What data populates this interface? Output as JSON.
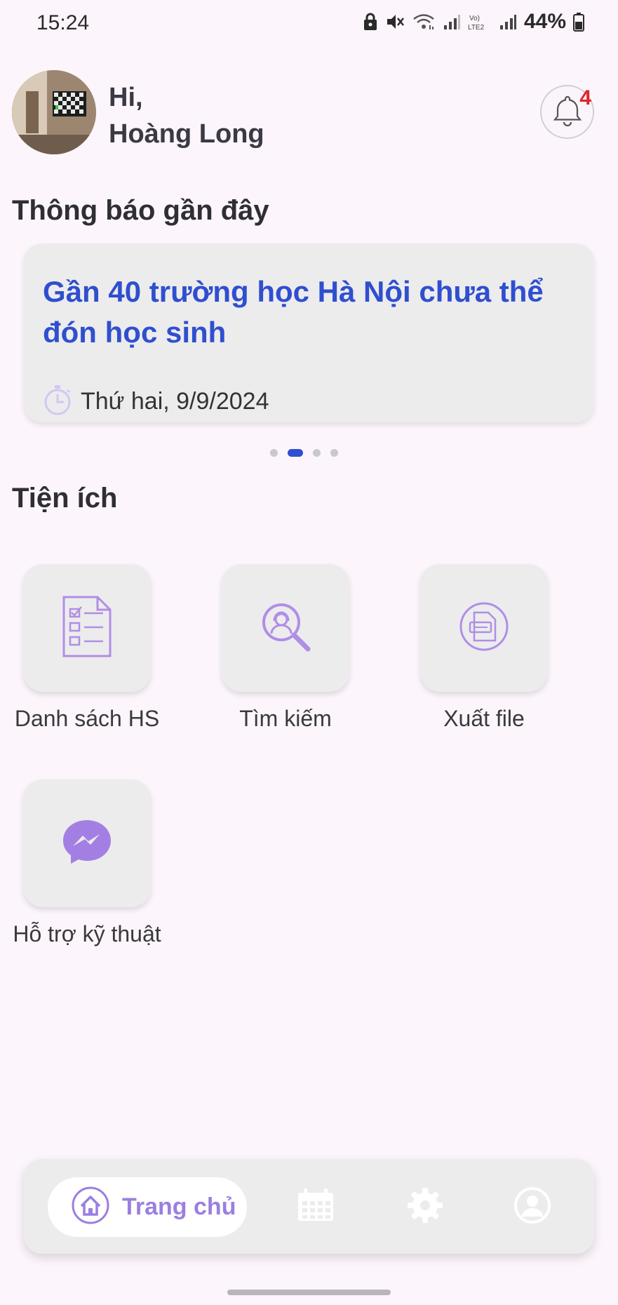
{
  "status_bar": {
    "time": "15:24",
    "battery": "44%",
    "network_label": "Vo) LTE2",
    "icons": [
      "lock-icon",
      "mute-icon",
      "wifi-icon",
      "signal-icon",
      "volte-icon",
      "signal-icon",
      "battery-icon"
    ]
  },
  "header": {
    "greeting": "Hi,",
    "user_name": "Hoàng Long",
    "notification_count": "4"
  },
  "notices": {
    "title": "Thông báo gần đây",
    "items": [
      {
        "title": "Gần 40 trường học Hà Nội chưa thể đón học sinh",
        "date": "Thứ hai, 9/9/2024"
      }
    ],
    "page_count": 4,
    "active_page": 2
  },
  "utilities": {
    "title": "Tiện ích",
    "items": [
      {
        "label": "Danh sách HS",
        "icon": "checklist-icon"
      },
      {
        "label": "Tìm kiếm",
        "icon": "search-person-icon"
      },
      {
        "label": "Xuất file",
        "icon": "file-export-icon"
      },
      {
        "label": "Hỗ trợ kỹ thuật",
        "icon": "messenger-icon"
      }
    ]
  },
  "bottom_nav": {
    "items": [
      {
        "label": "Trang chủ",
        "icon": "home-icon",
        "active": true
      },
      {
        "label": "",
        "icon": "calendar-icon",
        "active": false
      },
      {
        "label": "",
        "icon": "gear-icon",
        "active": false
      },
      {
        "label": "",
        "icon": "profile-icon",
        "active": false
      }
    ]
  },
  "colors": {
    "background": "#fcf5fb",
    "accent_blue": "#2f4fcf",
    "accent_purple": "#9b7fdf",
    "badge_red": "#e0242b",
    "tile": "#ececed"
  }
}
